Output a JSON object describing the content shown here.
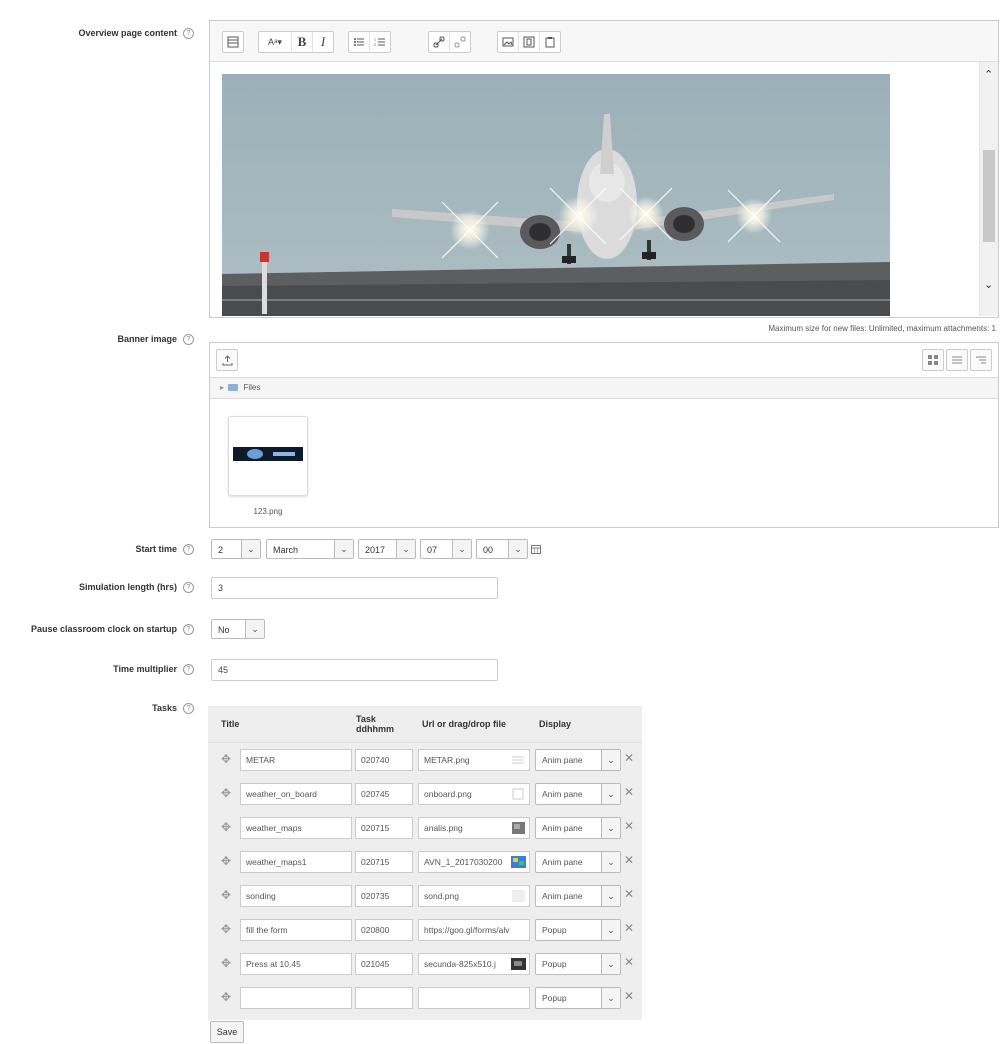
{
  "labels": {
    "overview": "Overview page content",
    "banner": "Banner image",
    "start_time": "Start time",
    "sim_length": "Simulation length (hrs)",
    "pause_clock": "Pause classroom clock on startup",
    "time_multiplier": "Time multiplier",
    "tasks": "Tasks"
  },
  "editor": {
    "toolbar": [
      "table-icon",
      "font-size-icon",
      "bold-icon",
      "italic-icon",
      "unordered-list-icon",
      "ordered-list-icon",
      "link-icon",
      "unlink-icon",
      "image-icon",
      "media-icon",
      "paste-icon"
    ],
    "bold": "B",
    "italic": "I"
  },
  "banner": {
    "max_note": "Maximum size for new files: Unlimited, maximum attachments: 1",
    "path": "Files",
    "file_name": "123.png"
  },
  "start_time": {
    "day": "2",
    "month": "March",
    "year": "2017",
    "hour": "07",
    "minute": "00"
  },
  "sim_length": "3",
  "pause_clock": "No",
  "time_multiplier": "45",
  "tasks": {
    "headers": {
      "title": "Title",
      "task_line1": "Task",
      "task_line2": "ddhhmm",
      "url": "Url or drag/drop file",
      "display": "Display"
    },
    "rows": [
      {
        "title": "METAR",
        "time": "020740",
        "url": "METAR.png",
        "display": "Anim pane"
      },
      {
        "title": "weather_on_board",
        "time": "020745",
        "url": "onboard.png",
        "display": "Anim pane"
      },
      {
        "title": "weather_maps",
        "time": "020715",
        "url": "analis.png",
        "display": "Anim pane"
      },
      {
        "title": "weather_maps1",
        "time": "020715",
        "url": "AVN_1_2017030200",
        "display": "Anim pane"
      },
      {
        "title": "sonding",
        "time": "020735",
        "url": "sond.png",
        "display": "Anim pane"
      },
      {
        "title": "fill the form",
        "time": "020800",
        "url": "https://goo.gl/forms/alv",
        "display": "Popup"
      },
      {
        "title": "Press at 10.45",
        "time": "021045",
        "url": "secunda-825x510.j",
        "display": "Popup"
      },
      {
        "title": "",
        "time": "",
        "url": "",
        "display": "Popup"
      }
    ]
  },
  "save_label": "Save"
}
